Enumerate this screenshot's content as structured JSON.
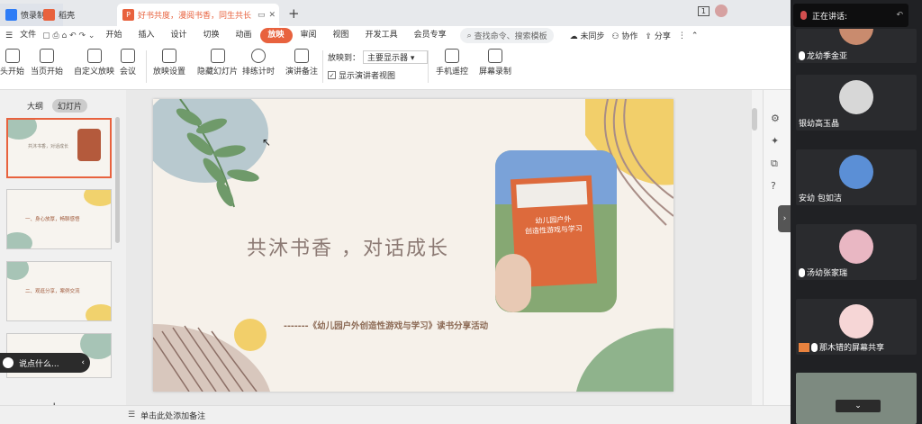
{
  "tabs": [
    {
      "label": "愤录制中",
      "color": "#2e7cf6"
    },
    {
      "label": "稻壳",
      "color": "#e8623e"
    },
    {
      "label": "好书共度，漫阅书香，同生共长",
      "color": "#e8623e"
    }
  ],
  "tab_controls": {
    "new_tab": "+",
    "page_indicator": "1"
  },
  "menu": {
    "file": "文件",
    "items": [
      "开始",
      "插入",
      "设计",
      "切换",
      "动画",
      "放映",
      "审阅",
      "视图",
      "开发工具",
      "会员专享"
    ],
    "active": "放映",
    "search_placeholder": "查找命令、搜索模板",
    "sync": "未同步",
    "collab": "协作",
    "share": "分享"
  },
  "ribbon": {
    "buttons": [
      "头开始",
      "当页开始",
      "自定义放映",
      "会议",
      "放映设置",
      "隐藏幻灯片",
      "排练计时",
      "演讲备注",
      "手机遥控",
      "屏幕录制"
    ],
    "play_to_label": "放映到：",
    "play_to_value": "主要显示器",
    "presenter_view": "显示演讲者视图"
  },
  "left_panel": {
    "tab_outline": "大纲",
    "tab_slides": "幻灯片",
    "thumbs": [
      {
        "title": "共沐书香，对话成长",
        "number": "1"
      },
      {
        "title": "一、身心放厚，畅聊感悟",
        "number": "2"
      },
      {
        "title": "二、观逛分享，案例交流",
        "number": "3"
      },
      {
        "title": "",
        "number": "4"
      }
    ],
    "comment_prompt": "说点什么...",
    "add": "+"
  },
  "slide": {
    "title": "共沐书香 ，对话成长",
    "subtitle": "-------《幼儿园户外创造性游戏与学习》读书分享活动",
    "book_title_line1": "幼儿园户外",
    "book_title_line2": "创造性游戏与学习"
  },
  "status": {
    "notes_placeholder": "单击此处添加备注"
  },
  "meeting": {
    "speaking_label": "正在讲话:",
    "participants": [
      "龙幼季金亚",
      "银幼高玉晶",
      "安幼  包如洁",
      "汤幼张家瑞",
      "那木错的屏幕共享"
    ],
    "expand": "⌄"
  },
  "colors": {
    "accent": "#e8623e",
    "meeting_bg": "#202124"
  }
}
